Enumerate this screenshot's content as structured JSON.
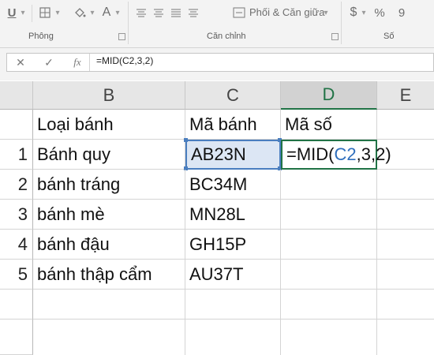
{
  "ribbon": {
    "groups": {
      "font": "Phông",
      "alignment": "Căn chỉnh",
      "number": "Số"
    },
    "buttons": {
      "merge_center": "Phối & Căn giữa",
      "currency_symbol": "$",
      "percent_symbol": "%",
      "comma_symbol": "9",
      "underline_symbol": "U",
      "font_color_symbol": "A"
    }
  },
  "formula_bar": {
    "cancel_symbol": "✕",
    "enter_symbol": "✓",
    "fx_symbol": "fx",
    "formula": "=MID(C2,3,2)"
  },
  "sheet": {
    "columns": [
      "B",
      "C",
      "D",
      "E"
    ],
    "active_column": "D",
    "header_row": {
      "b": "Loại bánh",
      "c": "Mã bánh",
      "d": "Mã số"
    },
    "rows": [
      {
        "num": "1",
        "b": "Bánh quy",
        "c": "AB23N"
      },
      {
        "num": "2",
        "b": "bánh tráng",
        "c": "BC34M"
      },
      {
        "num": "3",
        "b": "bánh mè",
        "c": "MN28L"
      },
      {
        "num": "4",
        "b": "bánh đậu",
        "c": "GH15P"
      },
      {
        "num": "5",
        "b": "bánh thập cẩm",
        "c": "AU37T"
      }
    ],
    "editing": {
      "prefix": "=MID(",
      "ref": "C2",
      "suffix": ",3,2)"
    }
  },
  "colors": {
    "excel_green": "#217346",
    "ref_blue": "#4a7ebf",
    "ref_fill": "#dce6f4"
  },
  "icons": [
    "underline-icon",
    "borders-icon",
    "fill-color-icon",
    "font-color-icon",
    "align-top-icon",
    "align-middle-icon",
    "align-bottom-icon",
    "wrap-text-icon",
    "merge-center-icon",
    "currency-icon",
    "percent-icon",
    "comma-style-icon",
    "cancel-icon",
    "enter-icon",
    "fx-icon"
  ]
}
